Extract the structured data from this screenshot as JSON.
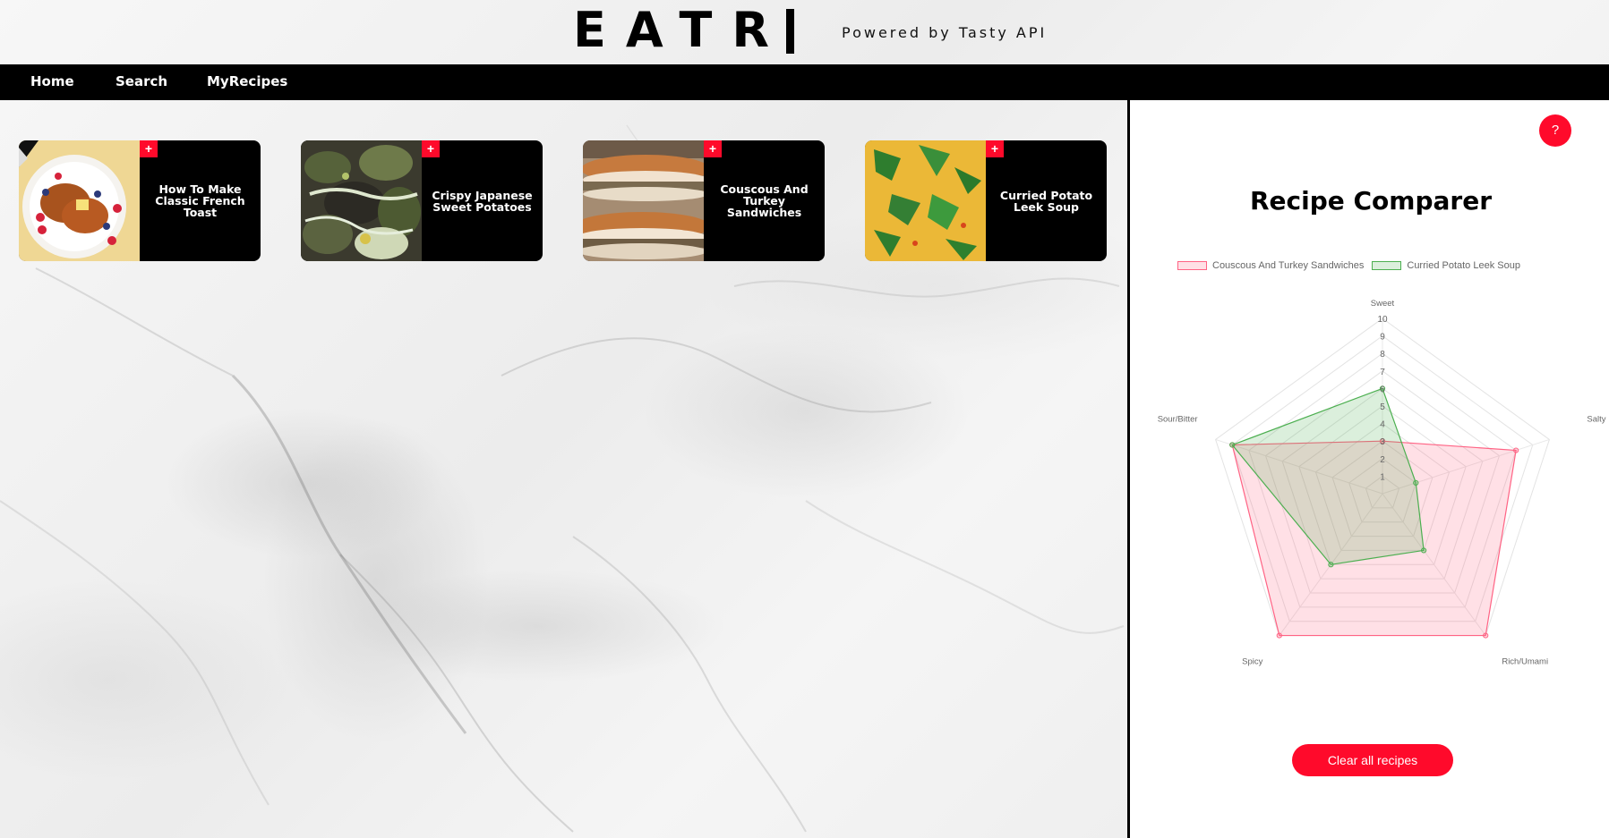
{
  "header": {
    "brand": "EATR",
    "tagline": "Powered by Tasty API"
  },
  "nav": {
    "items": [
      {
        "label": "Home"
      },
      {
        "label": "Search"
      },
      {
        "label": "MyRecipes"
      }
    ]
  },
  "recipes": [
    {
      "title": "How To Make Classic French Toast",
      "add_label": "+",
      "image": "french-toast-photo"
    },
    {
      "title": "Crispy Japanese Sweet Potatoes",
      "add_label": "+",
      "image": "sweet-potatoes-photo"
    },
    {
      "title": "Couscous And Turkey Sandwiches",
      "add_label": "+",
      "image": "sandwiches-photo"
    },
    {
      "title": "Curried Potato Leek Soup",
      "add_label": "+",
      "image": "soup-photo"
    }
  ],
  "comparer": {
    "help_label": "?",
    "title": "Recipe Comparer",
    "clear_label": "Clear all recipes"
  },
  "chart_data": {
    "type": "radar",
    "axes": [
      "Sweet",
      "Salty",
      "Rich/Umami",
      "Spicy",
      "Sour/Bitter"
    ],
    "ticks": [
      "1",
      "2",
      "3",
      "4",
      "5",
      "6",
      "7",
      "8",
      "9",
      "10"
    ],
    "rmin": 0,
    "rmax": 10,
    "legend_position": "top",
    "series": [
      {
        "name": "Couscous And Turkey Sandwiches",
        "values": [
          3,
          8,
          10,
          10,
          9
        ],
        "color": "#ff6384"
      },
      {
        "name": "Curried Potato Leek Soup",
        "values": [
          6,
          2,
          4,
          5,
          9
        ],
        "color": "#4caf50"
      }
    ]
  },
  "colors": {
    "accent": "#ff0a2b",
    "nav_bg": "#000000"
  }
}
